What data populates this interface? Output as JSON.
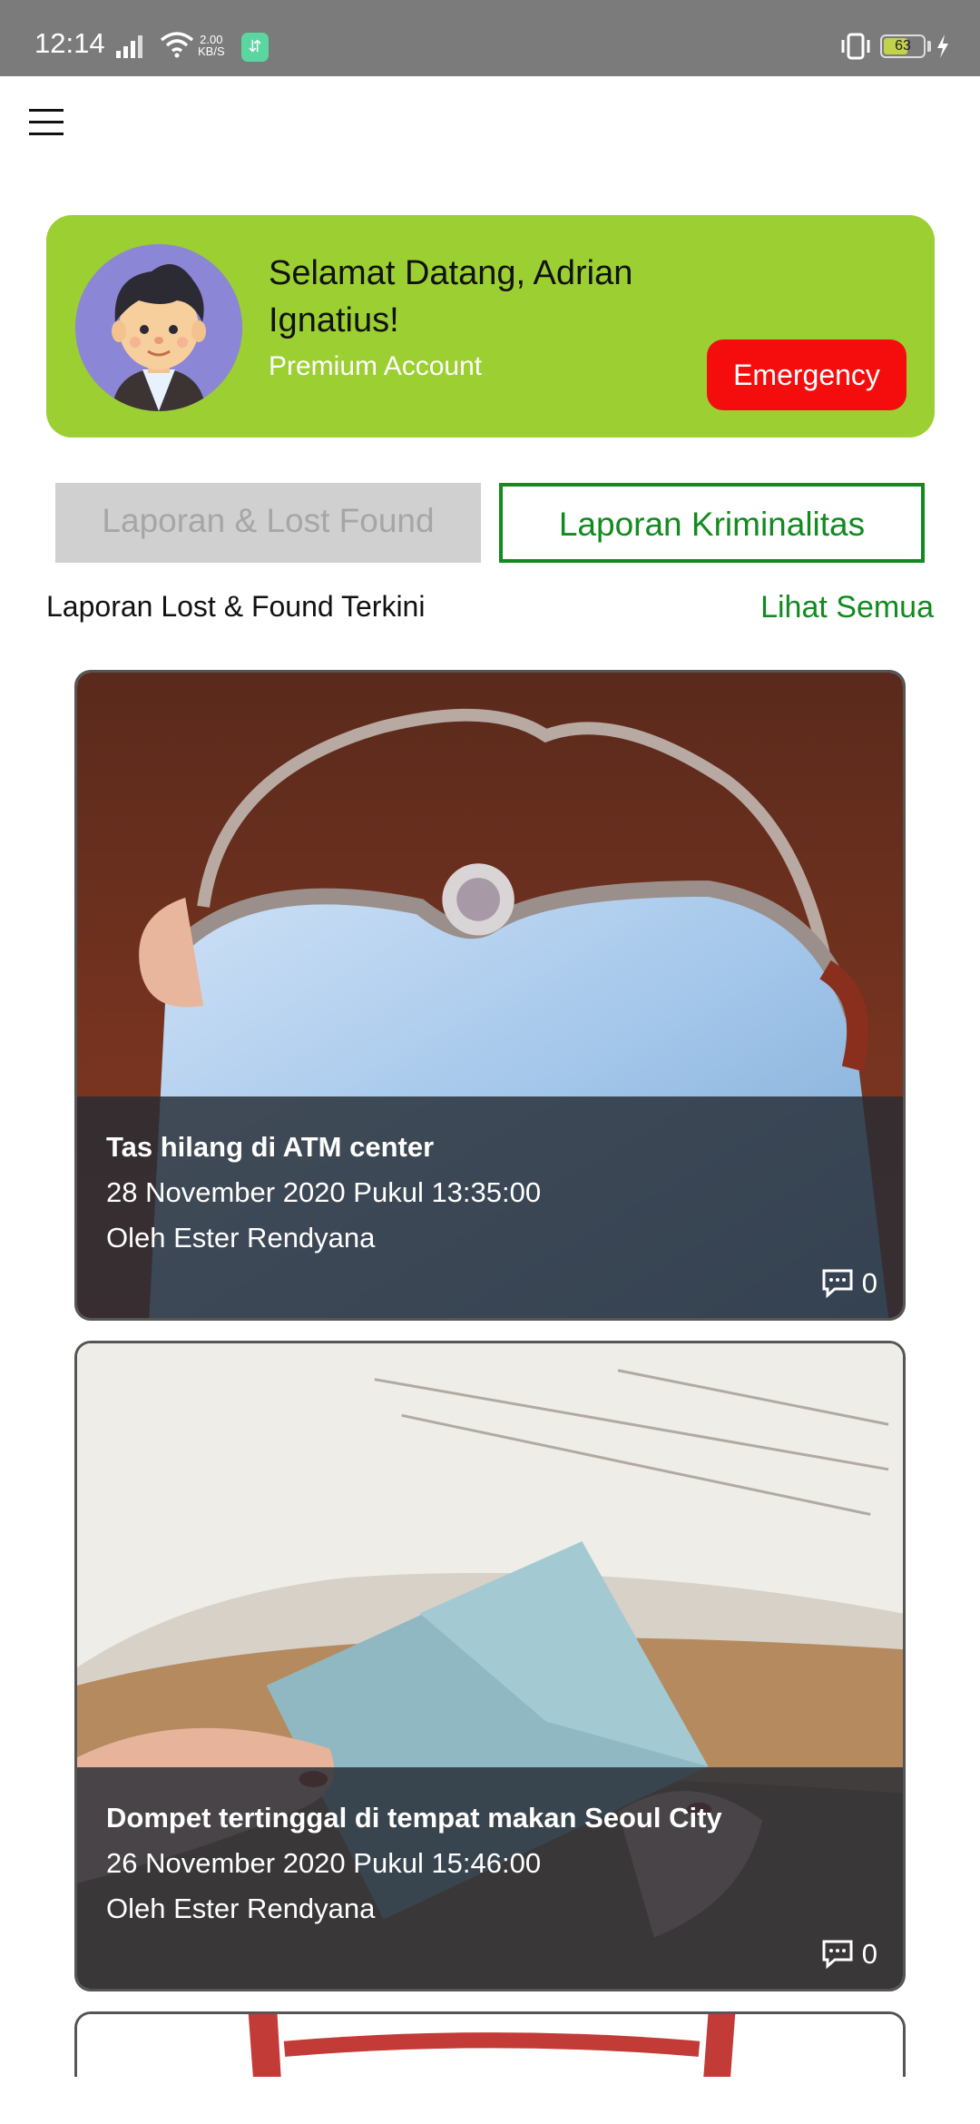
{
  "status_bar": {
    "time": "12:14",
    "net_speed_value": "2.00",
    "net_speed_unit": "KB/S",
    "battery_level": 63,
    "battery_label": "63"
  },
  "welcome": {
    "title": "Selamat Datang, Adrian Ignatius!",
    "account_type": "Premium Account",
    "emergency_label": "Emergency"
  },
  "tabs": [
    {
      "label": "Laporan & Lost Found",
      "active": false
    },
    {
      "label": "Laporan Kriminalitas",
      "active": true
    }
  ],
  "section": {
    "title": "Laporan Lost & Found Terkini",
    "see_all": "Lihat Semua"
  },
  "reports": [
    {
      "title": "Tas hilang di ATM center",
      "date": "28 November 2020 Pukul 13:35:00",
      "author": "Oleh Ester Rendyana",
      "comments": "0"
    },
    {
      "title": "Dompet tertinggal di tempat makan Seoul City",
      "date": "26 November 2020 Pukul 15:46:00",
      "author": "Oleh Ester Rendyana",
      "comments": "0"
    }
  ],
  "colors": {
    "accent_green": "#9bcf32",
    "tab_green": "#118a1f",
    "emergency_red": "#f50d0d"
  },
  "icons": [
    "menu-icon",
    "signal-icon",
    "wifi-icon",
    "vibrate-icon",
    "battery-icon",
    "charging-icon",
    "comment-icon"
  ]
}
